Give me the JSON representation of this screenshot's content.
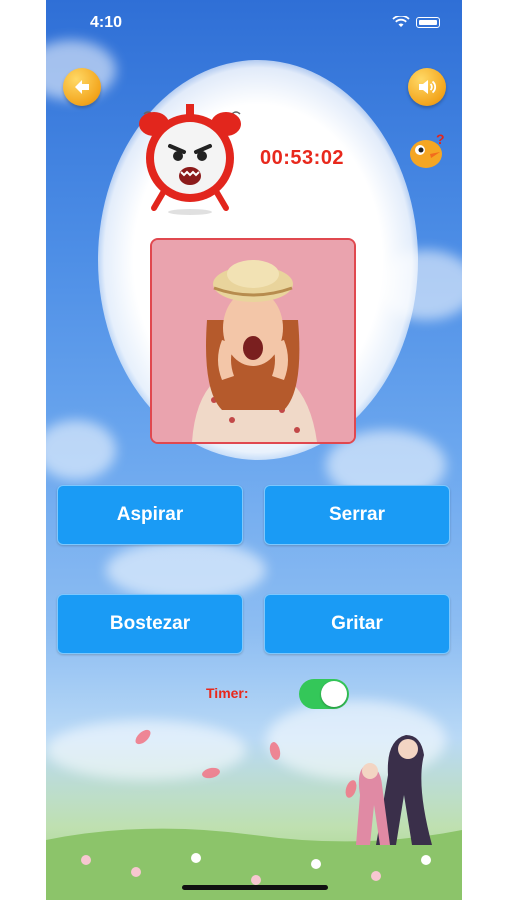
{
  "status_bar": {
    "time": "4:10"
  },
  "header": {
    "timer": "00:53:02"
  },
  "options": [
    "Aspirar",
    "Serrar",
    "Bostezar",
    "Gritar"
  ],
  "timer_toggle": {
    "label": "Timer:",
    "enabled": true
  },
  "colors": {
    "button": "#1a9bf5",
    "timer_text": "#e8281c",
    "toggle_on": "#34c759"
  },
  "icons": {
    "back": "back-arrow-icon",
    "sound": "speaker-icon",
    "clock": "alarm-clock-icon",
    "mascot": "question-bird-icon"
  }
}
